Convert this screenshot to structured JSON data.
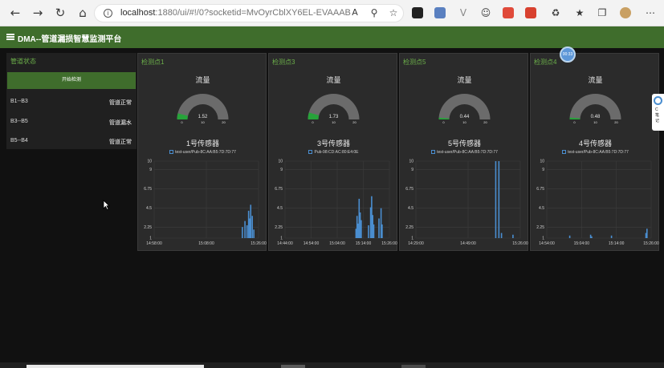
{
  "browser": {
    "url_main": "localhost",
    "url_rest": ":1880/ui/#!/0?socketid=MvOyrCblXY6EL-EVAAAB"
  },
  "app": {
    "title": "DMA--管道漏损智慧监测平台"
  },
  "sidebar": {
    "title": "管道状态",
    "start_button": "开始检测",
    "pipes": [
      {
        "name": "B1--B3",
        "status": "管道正常"
      },
      {
        "name": "B3--B5",
        "status": "管道漏水"
      },
      {
        "name": "B5--B4",
        "status": "管道正常"
      }
    ]
  },
  "badge": {
    "time": "00:33"
  },
  "float_panel": {
    "text": "C笔记"
  },
  "cards": [
    {
      "title": "检测点1",
      "gauge_label": "流量",
      "value": 1.52,
      "value_text": "1.52",
      "gauge_min": "0",
      "gauge_mid": "10",
      "gauge_max": "20",
      "sensor": "1号传感器",
      "legend": "test-user/Pub-8C:AA:B5:7D:7D:77",
      "chart_data": {
        "type": "bar",
        "y_ticks": [
          "10",
          "9",
          "6.75",
          "4.5",
          "2.25",
          "1"
        ],
        "x_ticks": [
          "14:58:00",
          "15:08:00",
          "15:26:00"
        ],
        "spikes": [
          {
            "t": 0.845,
            "v": 2.3
          },
          {
            "t": 0.87,
            "v": 3.0
          },
          {
            "t": 0.89,
            "v": 2.5
          },
          {
            "t": 0.905,
            "v": 4.2
          },
          {
            "t": 0.915,
            "v": 3.3
          },
          {
            "t": 0.925,
            "v": 4.9
          },
          {
            "t": 0.94,
            "v": 3.6
          },
          {
            "t": 0.955,
            "v": 2.0
          }
        ]
      }
    },
    {
      "title": "检测点3",
      "gauge_label": "流量",
      "value": 1.73,
      "value_text": "1.73",
      "gauge_min": "0",
      "gauge_mid": "10",
      "gauge_max": "20",
      "sensor": "3号传感器",
      "legend": "Pub-98:CD:AC:80:E4:0E",
      "chart_data": {
        "type": "bar",
        "y_ticks": [
          "10",
          "9",
          "6.75",
          "4.5",
          "2.25",
          "1"
        ],
        "x_ticks": [
          "14:44:00",
          "14:54:00",
          "15:04:00",
          "15:14:00",
          "15:26:00"
        ],
        "spikes": [
          {
            "t": 0.68,
            "v": 2.1
          },
          {
            "t": 0.69,
            "v": 3.6
          },
          {
            "t": 0.7,
            "v": 2.7
          },
          {
            "t": 0.71,
            "v": 5.6
          },
          {
            "t": 0.72,
            "v": 4.0
          },
          {
            "t": 0.73,
            "v": 3.1
          },
          {
            "t": 0.8,
            "v": 2.5
          },
          {
            "t": 0.82,
            "v": 4.6
          },
          {
            "t": 0.83,
            "v": 5.9
          },
          {
            "t": 0.84,
            "v": 3.7
          },
          {
            "t": 0.85,
            "v": 2.6
          },
          {
            "t": 0.9,
            "v": 3.3
          },
          {
            "t": 0.92,
            "v": 4.5
          },
          {
            "t": 0.93,
            "v": 2.6
          }
        ]
      }
    },
    {
      "title": "检测点5",
      "gauge_label": "流量",
      "value": 0.44,
      "value_text": "0.44",
      "gauge_min": "0",
      "gauge_mid": "10",
      "gauge_max": "20",
      "sensor": "5号传感器",
      "legend": "test-user/Pub-8C:AA:B5:7D:7D:77",
      "chart_data": {
        "type": "bar",
        "y_ticks": [
          "10",
          "9",
          "6.75",
          "4.5",
          "2.25",
          "1"
        ],
        "x_ticks": [
          "14:29:00",
          "14:49:00",
          "15:26:00"
        ],
        "spikes": [
          {
            "t": 0.765,
            "v": 10.0
          },
          {
            "t": 0.795,
            "v": 10.0
          },
          {
            "t": 0.82,
            "v": 1.6
          },
          {
            "t": 0.93,
            "v": 1.4
          }
        ]
      }
    },
    {
      "title": "检测点4",
      "gauge_label": "流量",
      "value": 0.48,
      "value_text": "0.48",
      "gauge_min": "0",
      "gauge_mid": "10",
      "gauge_max": "20",
      "sensor": "4号传感器",
      "legend": "test-user/Pub-8C:AA:B5:7D:7D:77",
      "chart_data": {
        "type": "bar",
        "y_ticks": [
          "10",
          "9",
          "6.75",
          "4.5",
          "2.25",
          "1"
        ],
        "x_ticks": [
          "14:54:00",
          "15:04:00",
          "15:14:00",
          "15:26:00"
        ],
        "spikes": [
          {
            "t": 0.22,
            "v": 1.3
          },
          {
            "t": 0.42,
            "v": 1.4
          },
          {
            "t": 0.43,
            "v": 1.2
          },
          {
            "t": 0.62,
            "v": 1.3
          },
          {
            "t": 0.95,
            "v": 1.6
          },
          {
            "t": 0.96,
            "v": 2.1
          }
        ]
      }
    }
  ],
  "colors": {
    "accent_green": "#3f6d2c",
    "title_green": "#6cb04a",
    "bar_blue": "#4a8ed0",
    "gauge_fill": "#27a33a",
    "gauge_track": "#6b6b6b"
  },
  "icons": [
    "back-icon",
    "forward-icon",
    "refresh-icon",
    "home-icon",
    "info-icon",
    "read-aloud-icon",
    "zoom-icon",
    "favorite-add-icon",
    "extension-icons",
    "favorites-icon",
    "collections-icon",
    "profile-icon",
    "menu-icon"
  ]
}
